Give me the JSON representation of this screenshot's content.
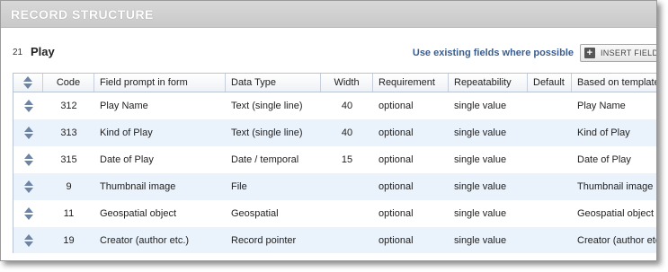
{
  "panel": {
    "title": "RECORD STRUCTURE"
  },
  "record_type": {
    "id": "21",
    "name": "Play"
  },
  "toolbar": {
    "use_existing_label": "Use existing fields where possible",
    "insert_label": "INSERT FIELD"
  },
  "table": {
    "headers": {
      "code": "Code",
      "prompt": "Field prompt in form",
      "type": "Data Type",
      "width": "Width",
      "requirement": "Requirement",
      "repeatability": "Repeatability",
      "default": "Default",
      "based": "Based on template"
    },
    "rows": [
      {
        "code": "312",
        "prompt": "Play Name",
        "type": "Text (single line)",
        "width": "40",
        "requirement": "optional",
        "repeatability": "single value",
        "default": "",
        "based": "Play Name"
      },
      {
        "code": "313",
        "prompt": "Kind of Play",
        "type": "Text (single line)",
        "width": "40",
        "requirement": "optional",
        "repeatability": "single value",
        "default": "",
        "based": "Kind of Play"
      },
      {
        "code": "315",
        "prompt": "Date of Play",
        "type": "Date / temporal",
        "width": "15",
        "requirement": "optional",
        "repeatability": "single value",
        "default": "",
        "based": "Date of Play"
      },
      {
        "code": "9",
        "prompt": "Thumbnail image",
        "type": "File",
        "width": "",
        "requirement": "optional",
        "repeatability": "single value",
        "default": "",
        "based": "Thumbnail image"
      },
      {
        "code": "11",
        "prompt": "Geospatial object",
        "type": "Geospatial",
        "width": "",
        "requirement": "optional",
        "repeatability": "single value",
        "default": "",
        "based": "Geospatial object"
      },
      {
        "code": "19",
        "prompt": "Creator (author etc.)",
        "type": "Record pointer",
        "width": "",
        "requirement": "optional",
        "repeatability": "single value",
        "default": "",
        "based": "Creator (author etc.)"
      }
    ]
  },
  "colors": {
    "title_bar": "#cfcfcf",
    "row_alt": "#eaf2fb",
    "link_blue": "#3a5d8f",
    "sort_icon": "#6e84a5"
  }
}
